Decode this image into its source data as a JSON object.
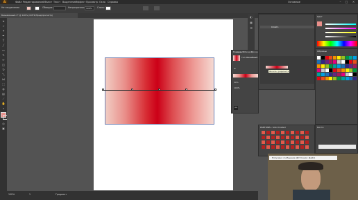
{
  "app": {
    "logo": "Ai",
    "menus": [
      "Файл",
      "Редактирование",
      "Объект",
      "Текст",
      "Выделение",
      "Эффект",
      "Просмотр",
      "Окно",
      "Справка"
    ],
    "workspace": "Основные"
  },
  "control_bar": {
    "selection_label": "Нет выделения",
    "stroke_label": "Обводка:",
    "opacity_label": "Непрозрачность:",
    "opacity_value": "100%",
    "style_label": "Стиль:"
  },
  "document": {
    "tab_title": "Безымянный-1* @ 100% (CMYK/Предпросмотр)"
  },
  "status_bar": {
    "zoom": "100%",
    "page": "1",
    "tool": "Градиент"
  },
  "gradient_panel": {
    "tabs": [
      "Градиент",
      "Обводка",
      "Прозр."
    ],
    "type_label": "Тип:",
    "type_value": "Линейный",
    "angle": "0°",
    "location": "50%",
    "opacity": "100%",
    "tooltip": "Шкала градиента"
  },
  "layers_panel": {
    "layer_name": "Слой 1"
  },
  "swatches_panel": {
    "title": "Образцы",
    "colors": [
      "#ffffff",
      "#000000",
      "#e30613",
      "#e94e1b",
      "#f39200",
      "#ffed00",
      "#95c11f",
      "#009640",
      "#00a19a",
      "#009fe3",
      "#1d71b8",
      "#312783",
      "#662483",
      "#a3195b",
      "#e6007e",
      "#c8c8c8"
    ]
  },
  "color_panel": {
    "title": "Цвет",
    "sliders": [
      "C",
      "M",
      "Y",
      "K"
    ]
  },
  "brushes_panel": {
    "title": "Кисти"
  },
  "symbols_panel": {
    "title": "Символы",
    "library_label": "PANTONE+ Solid Coated"
  },
  "notification": {
    "text": "Получено сообщение (Источник: файл)"
  },
  "colors": {
    "accent": "#f7a21b",
    "gradient_red": "#cc0017"
  }
}
